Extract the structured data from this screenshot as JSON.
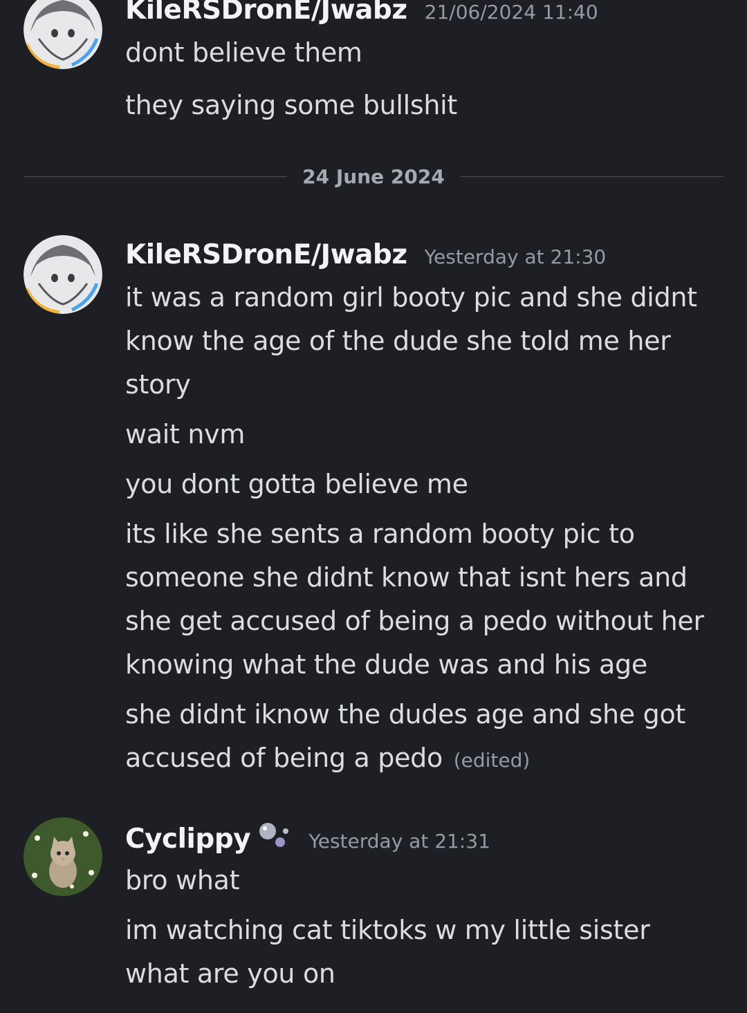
{
  "messages": [
    {
      "author": "KileRSDronE/Jwabz",
      "timestamp": "21/06/2024 11:40",
      "lines": [
        "dont believe them",
        "they saying some bullshit"
      ]
    },
    {
      "author": "KileRSDronE/Jwabz",
      "timestamp": "Yesterday at 21:30",
      "lines": [
        "it was a random girl booty pic and she didnt know the age of the dude she told me her story",
        "wait nvm",
        "you dont gotta believe me",
        "its like she sents a random booty pic to someone she didnt know that isnt hers and she get accused of being a pedo without her knowing what the dude was and his age",
        "she didnt iknow the dudes age and she got accused of being a pedo"
      ],
      "edited_label": "(edited)"
    },
    {
      "author": "Cyclippy",
      "timestamp": "Yesterday at 21:31",
      "lines": [
        "bro what",
        "im watching cat tiktoks w my little sister what are you on"
      ]
    }
  ],
  "date_divider": "24 June 2024",
  "icons": {
    "avatar_1": "anime-avatar-icon",
    "avatar_2": "cat-avatar-icon",
    "badge": "bubbles-icon"
  }
}
